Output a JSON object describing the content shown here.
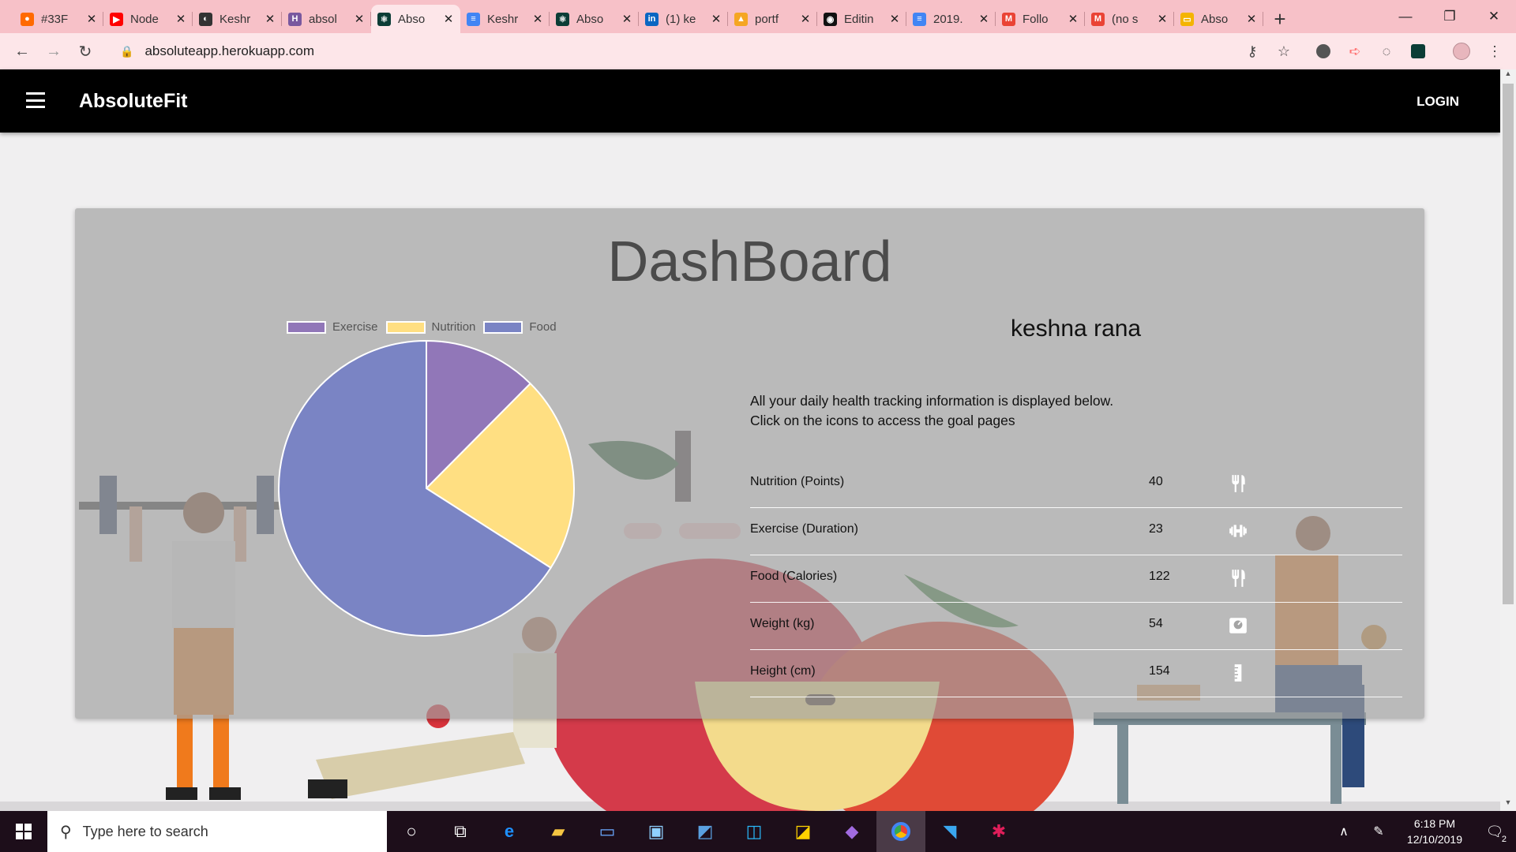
{
  "browser": {
    "tabs": [
      {
        "title": "#33F",
        "fav_color": "#ff6a00",
        "fav_glyph": "●"
      },
      {
        "title": "Node",
        "fav_color": "#ff0000",
        "fav_glyph": "▶"
      },
      {
        "title": "Keshr",
        "fav_color": "#333333",
        "fav_glyph": "◐"
      },
      {
        "title": "absol",
        "fav_color": "#79589f",
        "fav_glyph": "H"
      },
      {
        "title": "Abso",
        "fav_color": "#0b3d36",
        "fav_glyph": "⚛",
        "active": true
      },
      {
        "title": "Keshr",
        "fav_color": "#4285f4",
        "fav_glyph": "≡"
      },
      {
        "title": "Abso",
        "fav_color": "#0b3d36",
        "fav_glyph": "⚛"
      },
      {
        "title": "(1) ke",
        "fav_color": "#0a66c2",
        "fav_glyph": "in"
      },
      {
        "title": "portf",
        "fav_color": "#f5a623",
        "fav_glyph": "▲"
      },
      {
        "title": "Editin",
        "fav_color": "#111111",
        "fav_glyph": "◉"
      },
      {
        "title": "2019.",
        "fav_color": "#4285f4",
        "fav_glyph": "≡"
      },
      {
        "title": "Follo",
        "fav_color": "#ea4335",
        "fav_glyph": "M"
      },
      {
        "title": "(no s",
        "fav_color": "#ea4335",
        "fav_glyph": "M"
      },
      {
        "title": "Abso",
        "fav_color": "#f4b400",
        "fav_glyph": "▭"
      }
    ],
    "new_tab_glyph": "+",
    "url": "absoluteapp.herokuapp.com"
  },
  "app": {
    "brand": "AbsoluteFit",
    "login_label": "LOGIN"
  },
  "dashboard": {
    "title": "DashBoard",
    "user_name": "keshna rana",
    "intro_line1": "All your daily health tracking information is displayed below.",
    "intro_line2": "Click on the icons to access the goal pages",
    "stats": [
      {
        "label": "Nutrition (Points)",
        "value": "40",
        "icon": "fork-knife-icon"
      },
      {
        "label": "Exercise (Duration)",
        "value": "23",
        "icon": "dumbbell-icon"
      },
      {
        "label": "Food (Calories)",
        "value": "122",
        "icon": "fork-knife-icon"
      },
      {
        "label": "Weight (kg)",
        "value": "54",
        "icon": "scale-icon"
      },
      {
        "label": "Height (cm)",
        "value": "154",
        "icon": "ruler-icon"
      }
    ]
  },
  "chart_data": {
    "type": "pie",
    "categories": [
      "Exercise",
      "Nutrition",
      "Food"
    ],
    "values": [
      23,
      40,
      122
    ],
    "colors": [
      "#9177b8",
      "#ffdf82",
      "#7a84c4"
    ],
    "legend": "top"
  },
  "taskbar": {
    "search_placeholder": "Type here to search",
    "time": "6:18 PM",
    "date": "12/10/2019",
    "notification_count": "2"
  }
}
